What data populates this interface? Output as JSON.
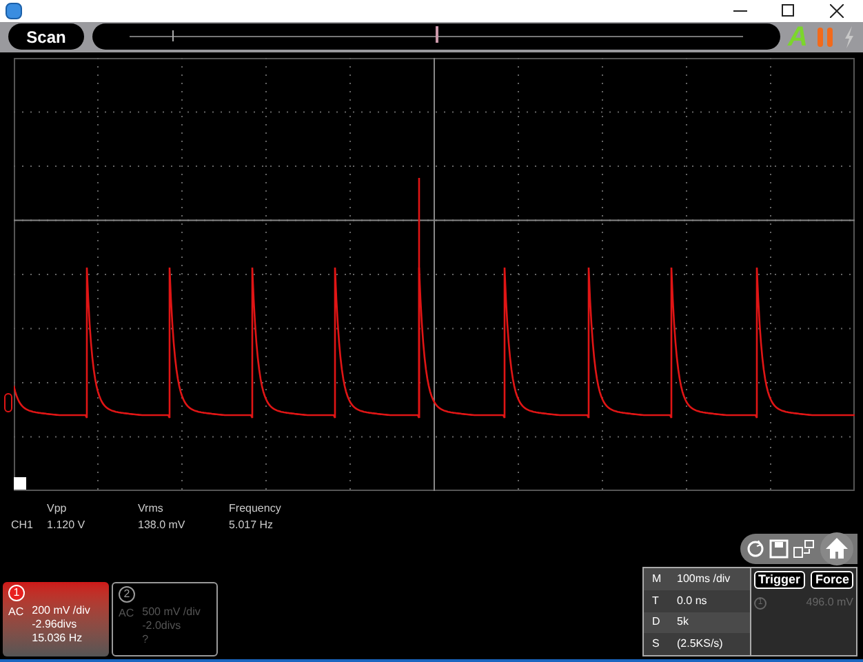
{
  "toolbar": {
    "scan_button": "Scan",
    "auto_button": "A",
    "slider_markers": [
      {
        "kind": "window",
        "level": 0.07
      },
      {
        "kind": "trigger",
        "level": 0.5
      }
    ]
  },
  "measurements": {
    "channel": "CH1",
    "items": [
      {
        "label": "Vpp",
        "value": "1.120 V"
      },
      {
        "label": "Vrms",
        "value": "138.0 mV"
      },
      {
        "label": "Frequency",
        "value": "5.017 Hz"
      }
    ]
  },
  "channels": [
    {
      "number": "1",
      "coupling": "AC",
      "scale": "200 mV /div",
      "offset": "-2.96divs",
      "frequency": "15.036 Hz",
      "selected": true
    },
    {
      "number": "2",
      "coupling": "AC",
      "scale": "500 mV /div",
      "offset": "-2.0divs",
      "frequency": "?",
      "selected": false
    }
  ],
  "timebase": [
    {
      "key": "M",
      "value": "100ms /div"
    },
    {
      "key": "T",
      "value": "0.0 ns"
    },
    {
      "key": "D",
      "value": "5k"
    },
    {
      "key": "S",
      "value": "(2.5KS/s)"
    }
  ],
  "trigger": {
    "buttons": [
      "Trigger",
      "Force"
    ],
    "source": "1",
    "level": "496.0 mV"
  }
}
